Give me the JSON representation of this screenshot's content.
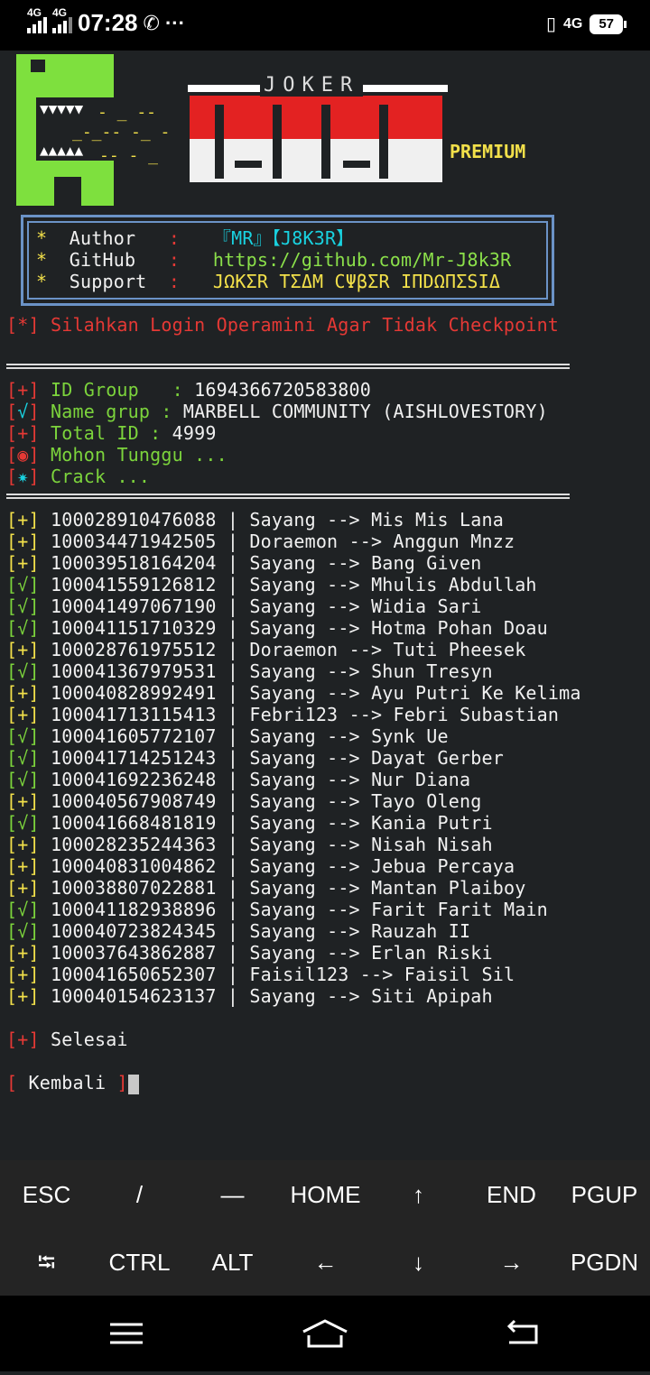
{
  "status_bar": {
    "network1": "4G",
    "network2": "4G",
    "time": "07:28",
    "icons": [
      "call-icon",
      "more-icon"
    ],
    "right_network": "4G",
    "battery": "57"
  },
  "banner": {
    "small_title": "JOKER",
    "premium": "PREMIUM"
  },
  "info": {
    "star": "*",
    "author_key": "Author",
    "author_val": "『MR』【J8K3R】",
    "github_key": "GitHub",
    "github_val": "https://github.com/Mr-J8k3R",
    "support_key": "Support",
    "support_val": "JΩKΣR TΣΔM CΨβΣR IΠDΩΠΣSIΔ",
    "colon": ":"
  },
  "notice": "[*] Silahkan Login Operamini Agar Tidak Checkpoint",
  "group": {
    "id_label": "ID Group   :",
    "id_value": "1694366720583800",
    "name_label": "Name grup :",
    "name_value": "MARBELL COMMUNITY (AISHLOVESTORY)",
    "total_label": "Total ID :",
    "total_value": "4999",
    "wait": "Mohon Tunggu ...",
    "crack": "Crack ..."
  },
  "results": [
    {
      "mark": "+",
      "id": "100028910476088",
      "pass": "Sayang",
      "name": "Mis Mis Lana"
    },
    {
      "mark": "+",
      "id": "100034471942505",
      "pass": "Doraemon",
      "name": "Anggun Mnzz"
    },
    {
      "mark": "+",
      "id": "100039518164204",
      "pass": "Sayang",
      "name": "Bang Given"
    },
    {
      "mark": "√",
      "id": "100041559126812",
      "pass": "Sayang",
      "name": "Mhulis Abdullah"
    },
    {
      "mark": "√",
      "id": "100041497067190",
      "pass": "Sayang",
      "name": "Widia Sari"
    },
    {
      "mark": "√",
      "id": "100041151710329",
      "pass": "Sayang",
      "name": "Hotma Pohan Doau"
    },
    {
      "mark": "+",
      "id": "100028761975512",
      "pass": "Doraemon",
      "name": "Tuti Pheesek"
    },
    {
      "mark": "√",
      "id": "100041367979531",
      "pass": "Sayang",
      "name": "Shun Tresyn"
    },
    {
      "mark": "+",
      "id": "100040828992491",
      "pass": "Sayang",
      "name": "Ayu Putri Ke Kelima"
    },
    {
      "mark": "+",
      "id": "100041713115413",
      "pass": "Febri123",
      "name": "Febri Subastian"
    },
    {
      "mark": "√",
      "id": "100041605772107",
      "pass": "Sayang",
      "name": "Synk Ue"
    },
    {
      "mark": "√",
      "id": "100041714251243",
      "pass": "Sayang",
      "name": "Dayat Gerber"
    },
    {
      "mark": "√",
      "id": "100041692236248",
      "pass": "Sayang",
      "name": "Nur Diana"
    },
    {
      "mark": "+",
      "id": "100040567908749",
      "pass": "Sayang",
      "name": "Tayo Oleng"
    },
    {
      "mark": "√",
      "id": "100041668481819",
      "pass": "Sayang",
      "name": "Kania Putri"
    },
    {
      "mark": "+",
      "id": "100028235244363",
      "pass": "Sayang",
      "name": "Nisah Nisah"
    },
    {
      "mark": "+",
      "id": "100040831004862",
      "pass": "Sayang",
      "name": "Jebua Percaya"
    },
    {
      "mark": "+",
      "id": "100038807022881",
      "pass": "Sayang",
      "name": "Mantan Plaiboy"
    },
    {
      "mark": "√",
      "id": "100041182938896",
      "pass": "Sayang",
      "name": "Farit Farit Main"
    },
    {
      "mark": "√",
      "id": "100040723824345",
      "pass": "Sayang",
      "name": "Rauzah II"
    },
    {
      "mark": "+",
      "id": "100037643862887",
      "pass": "Sayang",
      "name": "Erlan Riski"
    },
    {
      "mark": "+",
      "id": "100041650652307",
      "pass": "Faisil123",
      "name": "Faisil Sil"
    },
    {
      "mark": "+",
      "id": "100040154623137",
      "pass": "Sayang",
      "name": "Siti Apipah"
    }
  ],
  "done": "Selesai",
  "back": "Kembali",
  "keys_row1": [
    "ESC",
    "/",
    "—",
    "HOME",
    "↑",
    "END",
    "PGUP"
  ],
  "keys_row2": [
    "⭾",
    "CTRL",
    "ALT",
    "←",
    "↓",
    "→",
    "PGDN"
  ],
  "nav": [
    "menu-icon",
    "home-icon",
    "back-icon"
  ],
  "colors": {
    "red": "#e53935",
    "green": "#7cd43c",
    "yellow": "#f2e04a",
    "cyan": "#19d2e0",
    "bg": "#1f2224"
  }
}
